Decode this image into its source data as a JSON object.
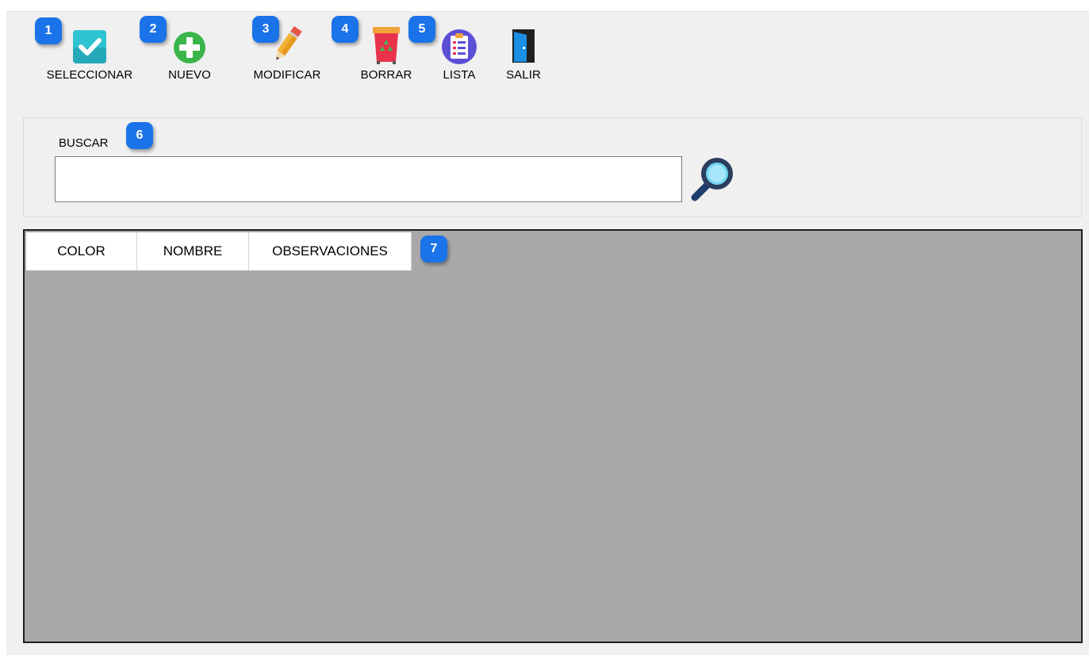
{
  "toolbar": {
    "seleccionar": "SELECCIONAR",
    "nuevo": "NUEVO",
    "modificar": "MODIFICAR",
    "borrar": "BORRAR",
    "lista": "LISTA",
    "salir": "SALIR"
  },
  "badges": [
    "1",
    "2",
    "3",
    "4",
    "5",
    "6",
    "7"
  ],
  "search": {
    "label": "BUSCAR",
    "value": "",
    "placeholder": ""
  },
  "grid": {
    "columns": [
      "COLOR",
      "NOMBRE",
      "OBSERVACIONES"
    ],
    "rows": []
  },
  "icons": {
    "seleccionar": "checkmark-icon",
    "nuevo": "plus-circle-icon",
    "modificar": "pencil-icon",
    "borrar": "trash-bin-icon",
    "lista": "clipboard-list-icon",
    "salir": "exit-door-icon",
    "buscar": "magnifier-icon"
  },
  "colors": {
    "badge": "#1a73e8",
    "window_bg": "#f0f0f0",
    "grid_bg": "#a9a9a9",
    "grid_border": "#1e1e1e"
  }
}
